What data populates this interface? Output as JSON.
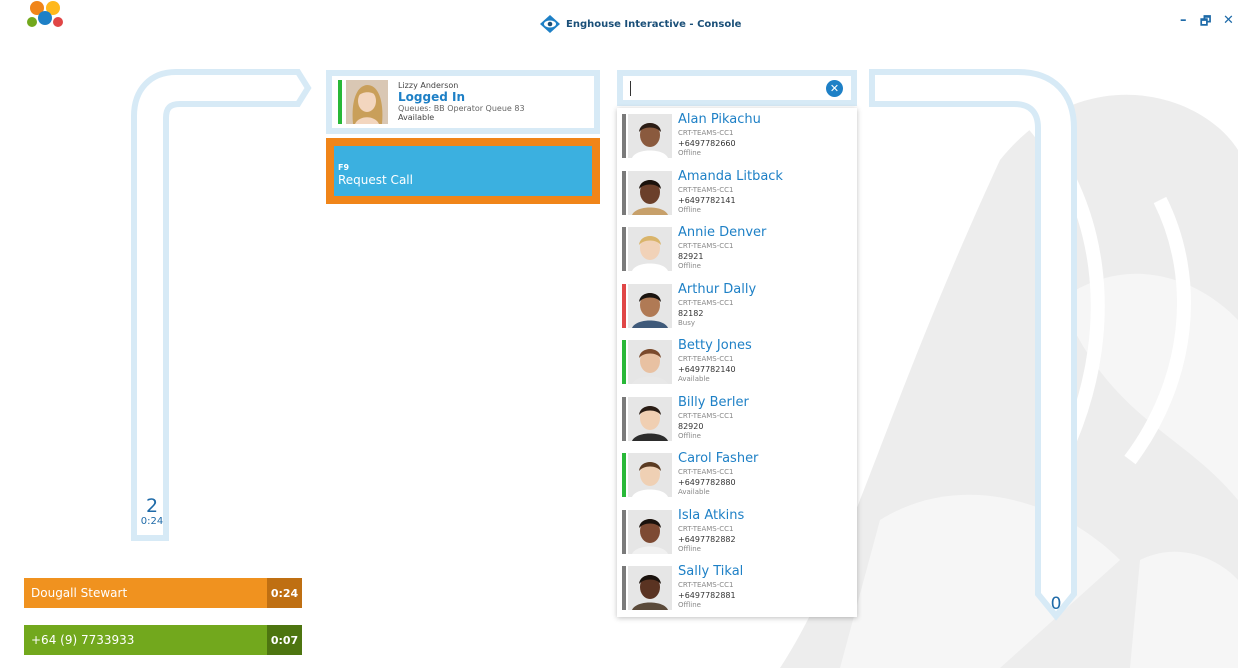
{
  "window": {
    "title": "Enghouse Interactive - Console",
    "controls": {
      "minimize": "–",
      "restore": "🗗",
      "close": "✕"
    }
  },
  "left_queue": {
    "count": "2",
    "time": "0:24"
  },
  "right_queue": {
    "count": "0"
  },
  "calls": [
    {
      "name": "Dougall Stewart",
      "time": "0:24",
      "color": "#f0921f",
      "time_color": "#bf6f12"
    },
    {
      "name": "+64 (9) 7733933",
      "time": "0:07",
      "color": "#72a81d",
      "time_color": "#4d7510"
    }
  ],
  "agent": {
    "name": "Lizzy Anderson",
    "state": "Logged In",
    "queues": "Queues: BB Operator Queue 83",
    "availability": "Available",
    "status_color": "#29b838"
  },
  "request_call": {
    "key": "F9",
    "label": "Request Call"
  },
  "search": {
    "value": "",
    "clear_icon": "close-circle-icon"
  },
  "contacts": [
    {
      "name": "Alan Pikachu",
      "team": "CRT-TEAMS-CC1",
      "phone": "+6497782660",
      "state": "Offline",
      "status_color": "#7a7a7a"
    },
    {
      "name": "Amanda Litback",
      "team": "CRT-TEAMS-CC1",
      "phone": "+6497782141",
      "state": "Offline",
      "status_color": "#7a7a7a"
    },
    {
      "name": "Annie Denver",
      "team": "CRT-TEAMS-CC1",
      "phone": "82921",
      "state": "Offline",
      "status_color": "#7a7a7a"
    },
    {
      "name": "Arthur Dally",
      "team": "CRT-TEAMS-CC1",
      "phone": "82182",
      "state": "Busy",
      "status_color": "#e04646"
    },
    {
      "name": "Betty Jones",
      "team": "CRT-TEAMS-CC1",
      "phone": "+6497782140",
      "state": "Available",
      "status_color": "#29b838"
    },
    {
      "name": "Billy Berler",
      "team": "CRT-TEAMS-CC1",
      "phone": "82920",
      "state": "Offline",
      "status_color": "#7a7a7a"
    },
    {
      "name": "Carol Fasher",
      "team": "CRT-TEAMS-CC1",
      "phone": "+6497782880",
      "state": "Available",
      "status_color": "#29b838"
    },
    {
      "name": "Isla Atkins",
      "team": "CRT-TEAMS-CC1",
      "phone": "+6497782882",
      "state": "Offline",
      "status_color": "#7a7a7a"
    },
    {
      "name": "Sally Tikal",
      "team": "CRT-TEAMS-CC1",
      "phone": "+6497782881",
      "state": "Offline",
      "status_color": "#7a7a7a"
    }
  ]
}
